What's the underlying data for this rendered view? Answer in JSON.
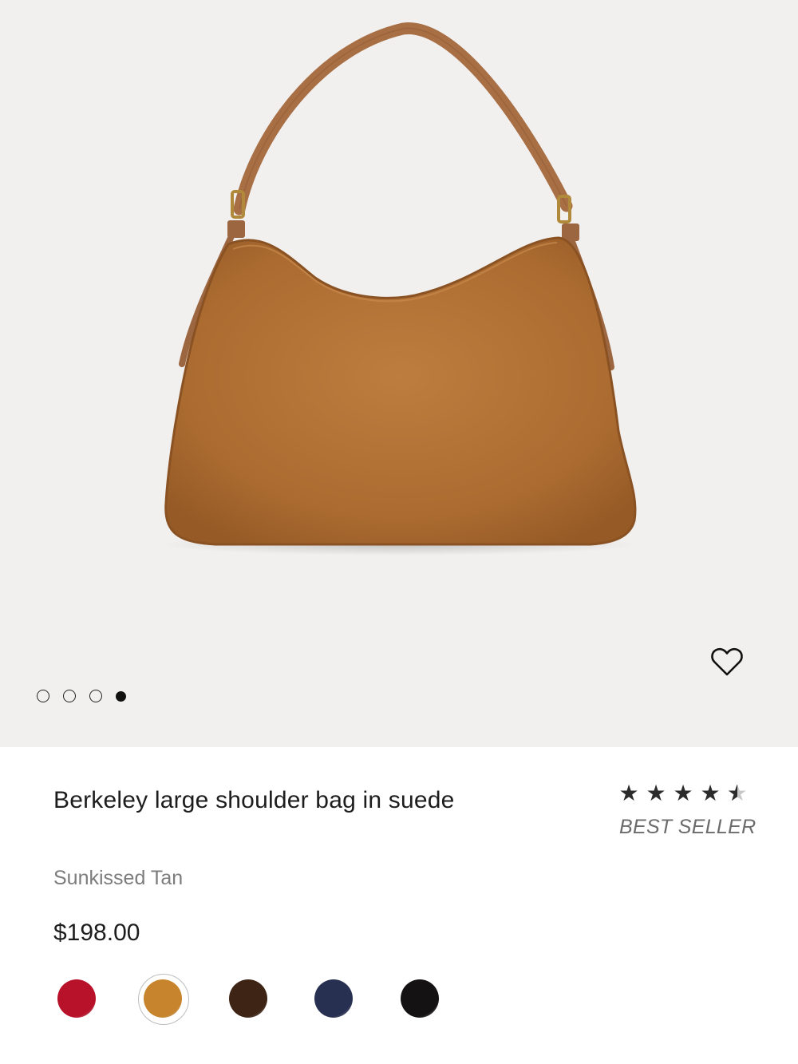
{
  "product": {
    "title": "Berkeley large shoulder bag in suede",
    "color_name": "Sunkissed Tan",
    "price": "$198.00",
    "badge": "BEST SELLER",
    "rating": 4.5,
    "rating_max": 5
  },
  "gallery": {
    "image_count": 4,
    "active_index": 3
  },
  "swatches": [
    {
      "name": "red",
      "color": "#b8112a"
    },
    {
      "name": "sunkissed-tan",
      "color": "#c8842c",
      "selected": true
    },
    {
      "name": "brown",
      "color": "#3e2414"
    },
    {
      "name": "navy",
      "color": "#283052"
    },
    {
      "name": "black",
      "color": "#141212"
    }
  ],
  "colors": {
    "hero_bg": "#f1f0ef",
    "bag_suede": "#b27236",
    "strap_leather": "#a86f45"
  },
  "icons": {
    "wishlist": "heart-outline-icon",
    "star": "star-icon"
  }
}
